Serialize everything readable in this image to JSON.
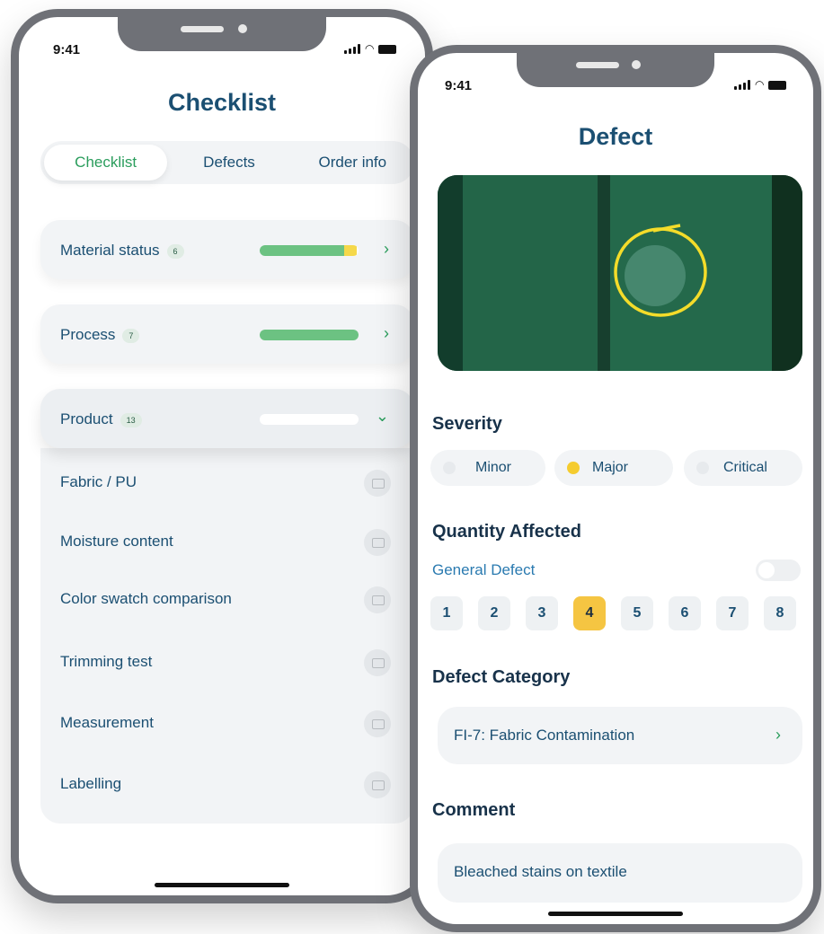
{
  "left": {
    "time": "9:41",
    "title": "Checklist",
    "tabs": [
      {
        "label": "Checklist",
        "active": true
      },
      {
        "label": "Defects",
        "active": false
      },
      {
        "label": "Order info",
        "active": false
      }
    ],
    "sections": [
      {
        "label": "Material status",
        "count": "6",
        "progress": 0.85,
        "warning": 0.13,
        "expanded": false
      },
      {
        "label": "Process",
        "count": "7",
        "progress": 1.0,
        "warning": 0,
        "expanded": false
      },
      {
        "label": "Product",
        "count": "13",
        "progress": 0,
        "warning": 0,
        "expanded": true
      }
    ],
    "items": [
      {
        "label": "Fabric / PU",
        "icon": "camera-icon"
      },
      {
        "label": "Moisture content",
        "icon": "camera-icon"
      },
      {
        "label": "Color swatch comparison",
        "icon": "camera-icon"
      },
      {
        "label": "Trimming test",
        "icon": "video-icon"
      },
      {
        "label": "Measurement",
        "icon": "camera-icon"
      },
      {
        "label": "Labelling",
        "icon": "camera-icon"
      }
    ]
  },
  "right": {
    "time": "9:41",
    "title": "Defect",
    "severity_heading": "Severity",
    "severity": [
      {
        "label": "Minor",
        "selected": false
      },
      {
        "label": "Major",
        "selected": true
      },
      {
        "label": "Critical",
        "selected": false
      }
    ],
    "quantity_heading": "Quantity Affected",
    "general_defect_label": "General Defect",
    "quantities": [
      "1",
      "2",
      "3",
      "4",
      "5",
      "6",
      "7",
      "8"
    ],
    "selected_quantity": "4",
    "category_heading": "Defect Category",
    "category_value": "FI-7: Fabric Contamination",
    "comment_heading": "Comment",
    "comment_value": "Bleached stains on textile"
  },
  "colors": {
    "accent_green": "#2a9d5c",
    "progress_green": "#6cc282",
    "warning_yellow": "#f5d84a",
    "selected_yellow": "#f5c542",
    "text_blue": "#1b4f72",
    "frame_gray": "#6f7177"
  }
}
